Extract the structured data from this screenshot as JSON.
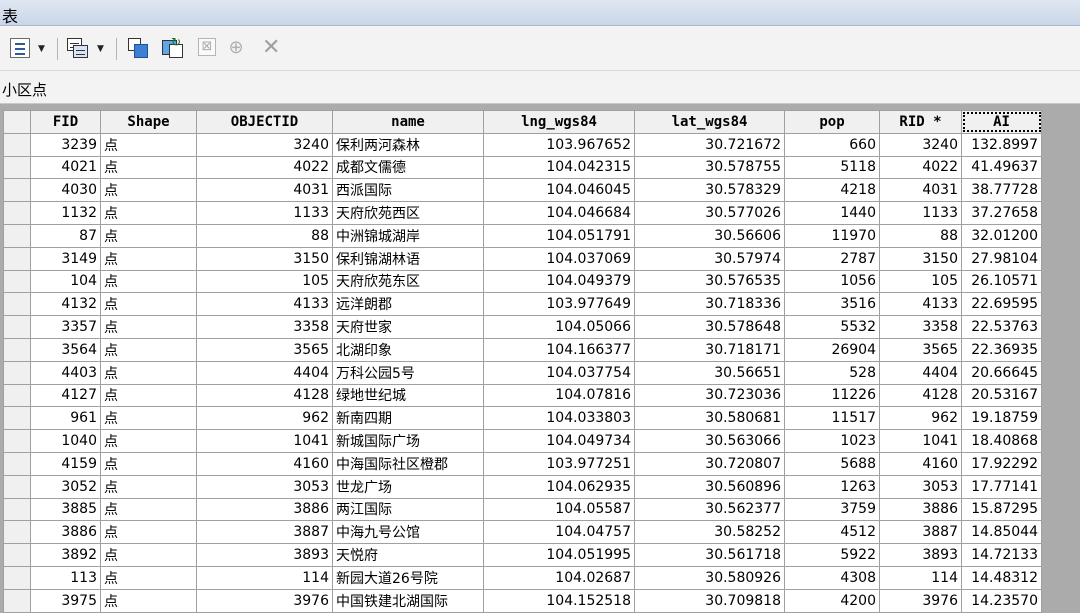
{
  "window": {
    "title": "表"
  },
  "toolbar": {
    "icons": [
      "table-options-icon",
      "related-tables-icon",
      "select-by-attributes-icon",
      "switch-selection-icon",
      "clear-selection-icon",
      "zoom-to-selected-icon",
      "delete-selected-icon"
    ]
  },
  "table": {
    "name": "小区点",
    "columns": [
      "FID",
      "Shape",
      "OBJECTID",
      "name",
      "lng_wgs84",
      "lat_wgs84",
      "pop",
      "RID *",
      "AI"
    ],
    "rows": [
      [
        "3239",
        "点",
        "3240",
        "保利两河森林",
        "103.967652",
        "30.721672",
        "660",
        "3240",
        "132.8997"
      ],
      [
        "4021",
        "点",
        "4022",
        "成都文儒德",
        "104.042315",
        "30.578755",
        "5118",
        "4022",
        "41.49637"
      ],
      [
        "4030",
        "点",
        "4031",
        "西派国际",
        "104.046045",
        "30.578329",
        "4218",
        "4031",
        "38.77728"
      ],
      [
        "1132",
        "点",
        "1133",
        "天府欣苑西区",
        "104.046684",
        "30.577026",
        "1440",
        "1133",
        "37.27658"
      ],
      [
        "87",
        "点",
        "88",
        "中洲锦城湖岸",
        "104.051791",
        "30.56606",
        "11970",
        "88",
        "32.01200"
      ],
      [
        "3149",
        "点",
        "3150",
        "保利锦湖林语",
        "104.037069",
        "30.57974",
        "2787",
        "3150",
        "27.98104"
      ],
      [
        "104",
        "点",
        "105",
        "天府欣苑东区",
        "104.049379",
        "30.576535",
        "1056",
        "105",
        "26.10571"
      ],
      [
        "4132",
        "点",
        "4133",
        "远洋朗郡",
        "103.977649",
        "30.718336",
        "3516",
        "4133",
        "22.69595"
      ],
      [
        "3357",
        "点",
        "3358",
        "天府世家",
        "104.05066",
        "30.578648",
        "5532",
        "3358",
        "22.53763"
      ],
      [
        "3564",
        "点",
        "3565",
        "北湖印象",
        "104.166377",
        "30.718171",
        "26904",
        "3565",
        "22.36935"
      ],
      [
        "4403",
        "点",
        "4404",
        "万科公园5号",
        "104.037754",
        "30.56651",
        "528",
        "4404",
        "20.66645"
      ],
      [
        "4127",
        "点",
        "4128",
        "绿地世纪城",
        "104.07816",
        "30.723036",
        "11226",
        "4128",
        "20.53167"
      ],
      [
        "961",
        "点",
        "962",
        "新南四期",
        "104.033803",
        "30.580681",
        "11517",
        "962",
        "19.18759"
      ],
      [
        "1040",
        "点",
        "1041",
        "新城国际广场",
        "104.049734",
        "30.563066",
        "1023",
        "1041",
        "18.40868"
      ],
      [
        "4159",
        "点",
        "4160",
        "中海国际社区橙郡",
        "103.977251",
        "30.720807",
        "5688",
        "4160",
        "17.92292"
      ],
      [
        "3052",
        "点",
        "3053",
        "世龙广场",
        "104.062935",
        "30.560896",
        "1263",
        "3053",
        "17.77141"
      ],
      [
        "3885",
        "点",
        "3886",
        "两江国际",
        "104.05587",
        "30.562377",
        "3759",
        "3886",
        "15.87295"
      ],
      [
        "3886",
        "点",
        "3887",
        "中海九号公馆",
        "104.04757",
        "30.58252",
        "4512",
        "3887",
        "14.85044"
      ],
      [
        "3892",
        "点",
        "3893",
        "天悦府",
        "104.051995",
        "30.561718",
        "5922",
        "3893",
        "14.72133"
      ],
      [
        "113",
        "点",
        "114",
        "新园大道26号院",
        "104.02687",
        "30.580926",
        "4308",
        "114",
        "14.48312"
      ],
      [
        "3975",
        "点",
        "3976",
        "中国铁建北湖国际",
        "104.152518",
        "30.709818",
        "4200",
        "3976",
        "14.23570"
      ]
    ]
  }
}
